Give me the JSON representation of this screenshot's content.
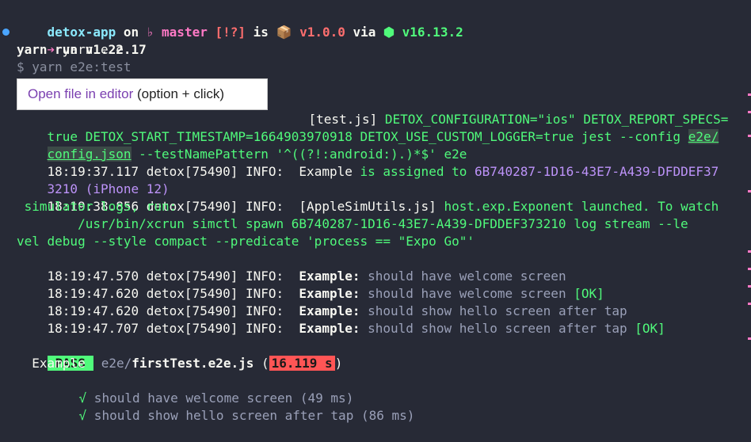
{
  "prompt": {
    "dir": "detox-app",
    "on": " on ",
    "git_icon": "♭",
    "branch": " master ",
    "status": "[!?]",
    "is": " is ",
    "pkg_icon": "📦",
    "version": " v1.0.0 ",
    "via": "via ",
    "node_icon": "⬢",
    "node_version": " v16.13.2"
  },
  "command": {
    "arrow": "➔",
    "text": " yarn e2e"
  },
  "lines": {
    "yarn_run": "yarn run v1.22.17",
    "script": "$ yarn e2e:test",
    "cmd1_tail": "[test.js] ",
    "cmd1_env": "DETOX_CONFIGURATION=\"ios\" DETOX_REPORT_SPECS=",
    "cmd2": "true DETOX_START_TIMESTAMP=1664903970918 DETOX_USE_CUSTOM_LOGGER=true jest --config ",
    "cmd2_link": "e2e/",
    "cmd3_link": "config.json",
    "cmd3": " --testNamePattern '^((?!:android:).)*$' e2e",
    "l1_time": "18:19:37.117 detox[75490] INFO:  ",
    "l1_a": "Example",
    "l1_b": " is assigned to ",
    "l1_id": "6B740287-1D16-43E7-A439-DFDDEF37",
    "l1_id2": "3210",
    "l1_dev": " (iPhone 12)",
    "l2_time": "18:19:38.856 detox[75490] INFO:  ",
    "l2_a": "[AppleSimUtils.js] ",
    "l2_b": "host.exp.Exponent launched. To watch",
    "l2_c": " simulator logs, run:",
    "l2_d": "        /usr/bin/xcrun simctl spawn 6B740287-1D16-43E7-A439-DFDDEF373210 log stream --le",
    "l2_e": "vel debug --style compact --predicate 'process == \"Expo Go\"'",
    "l3_time": "18:19:47.570 detox[75490] INFO:  ",
    "l3_b": " should have welcome screen",
    "l4_time": "18:19:47.620 detox[75490] INFO:  ",
    "l4_b": " should have welcome screen ",
    "l5_time": "18:19:47.620 detox[75490] INFO:  ",
    "l5_b": " should show hello screen after tap",
    "l6_time": "18:19:47.707 detox[75490] INFO:  ",
    "l6_b": " should show hello screen after tap ",
    "example_label": "Example:",
    "ok": "[OK]"
  },
  "tooltip": {
    "action": "Open file in editor",
    "hint": " (option + click)"
  },
  "result": {
    "pass": "PASS",
    "path": " e2e/",
    "file": "firstTest.e2e.js",
    "paren_open": " (",
    "duration": "16.119 s",
    "paren_close": ")",
    "suite": "  Example",
    "checkmark": "√",
    "test1": " should have welcome screen (49 ms)",
    "test2": " should show hello screen after tap (86 ms)"
  }
}
